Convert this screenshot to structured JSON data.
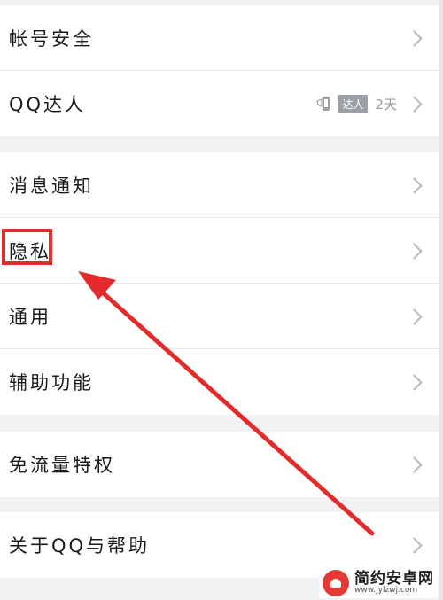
{
  "settings": {
    "group1": [
      {
        "label": "帐号安全"
      },
      {
        "label": "QQ达人",
        "badge": "达人",
        "days": "2天"
      }
    ],
    "group2": [
      {
        "label": "消息通知"
      },
      {
        "label": "隐私"
      },
      {
        "label": "通用"
      },
      {
        "label": "辅助功能"
      }
    ],
    "group3": [
      {
        "label": "免流量特权"
      }
    ],
    "group4": [
      {
        "label": "关于QQ与帮助"
      }
    ]
  },
  "annotation": {
    "color": "#e32b2b",
    "target": "隐私"
  },
  "watermark": {
    "title": "简约安卓网",
    "url": "www.jylzwj.com"
  }
}
